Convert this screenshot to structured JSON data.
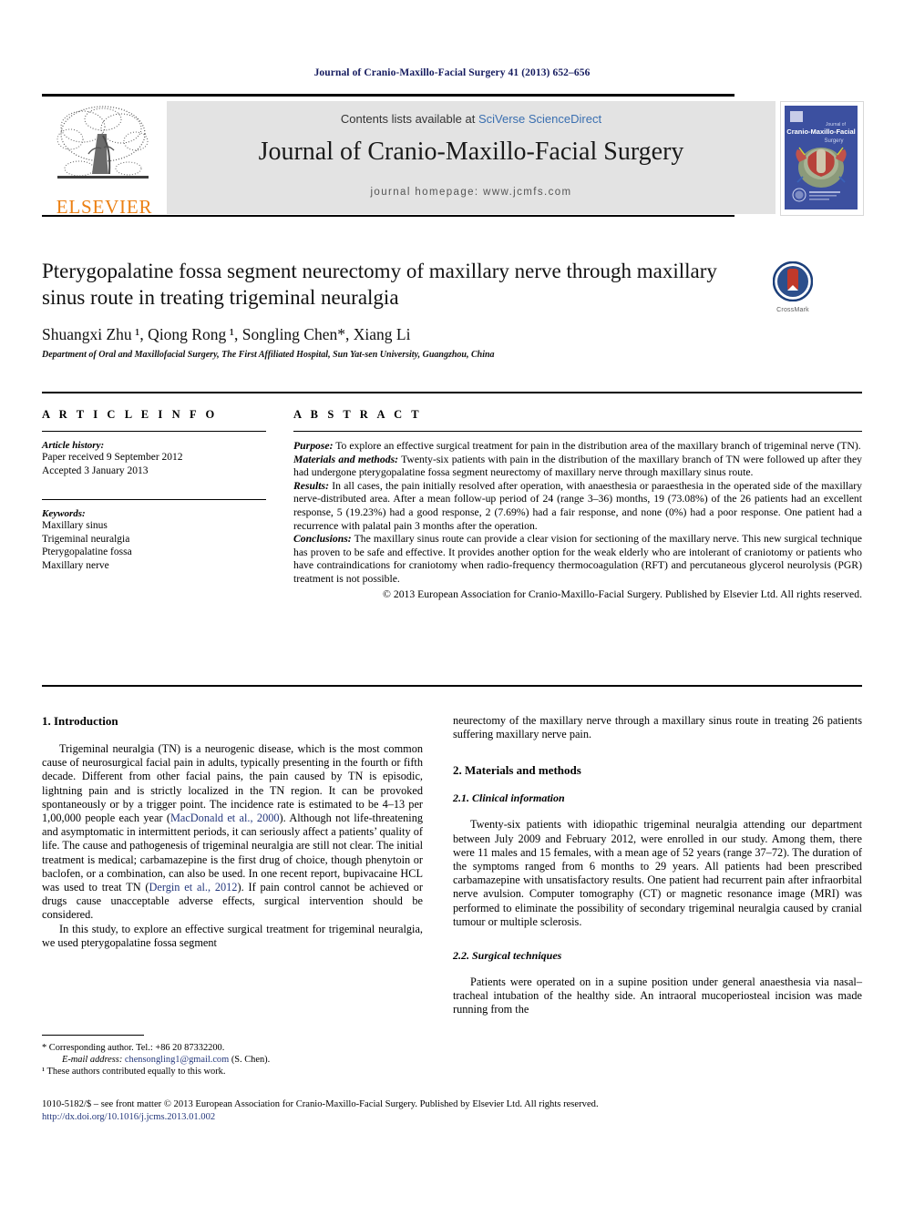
{
  "running_head": "Journal of Cranio-Maxillo-Facial Surgery 41 (2013) 652–656",
  "masthead": {
    "contents_prefix": "Contents lists available at ",
    "contents_link": "SciVerse ScienceDirect",
    "journal_name": "Journal of Cranio-Maxillo-Facial Surgery",
    "homepage": "journal homepage: www.jcmfs.com",
    "publisher_logo_text": "ELSEVIER",
    "cover_title_line1": "Journal of",
    "cover_title_line2": "Cranio-Maxillo-Facial",
    "cover_title_line3": "Surgery",
    "cover_bg_color": "#3c50a0"
  },
  "article": {
    "title": "Pterygopalatine fossa segment neurectomy of maxillary nerve through maxillary sinus route in treating trigeminal neuralgia",
    "authors": "Shuangxi Zhu ¹, Qiong Rong ¹, Songling Chen*, Xiang Li",
    "affiliation": "Department of Oral and Maxillofacial Surgery, The First Affiliated Hospital, Sun Yat-sen University, Guangzhou, China",
    "crossmark_label": "CrossMark"
  },
  "article_info": {
    "heading": "A R T I C L E   I N F O",
    "history_label": "Article history:",
    "history_lines": [
      "Paper received 9 September 2012",
      "Accepted 3 January 2013"
    ],
    "keywords_label": "Keywords:",
    "keywords": [
      "Maxillary sinus",
      "Trigeminal neuralgia",
      "Pterygopalatine fossa",
      "Maxillary nerve"
    ]
  },
  "abstract": {
    "heading": "A B S T R A C T",
    "purpose_label": "Purpose:",
    "purpose_text": " To explore an effective surgical treatment for pain in the distribution area of the maxillary branch of trigeminal nerve (TN).",
    "materials_label": "Materials and methods:",
    "materials_text": " Twenty-six patients with pain in the distribution of the maxillary branch of TN were followed up after they had undergone pterygopalatine fossa segment neurectomy of maxillary nerve through maxillary sinus route.",
    "results_label": "Results:",
    "results_text": " In all cases, the pain initially resolved after operation, with anaesthesia or paraesthesia in the operated side of the maxillary nerve-distributed area. After a mean follow-up period of 24 (range 3–36) months, 19 (73.08%) of the 26 patients had an excellent response, 5 (19.23%) had a good response, 2 (7.69%) had a fair response, and none (0%) had a poor response. One patient had a recurrence with palatal pain 3 months after the operation.",
    "conclusions_label": "Conclusions:",
    "conclusions_text": " The maxillary sinus route can provide a clear vision for sectioning of the maxillary nerve. This new surgical technique has proven to be safe and effective. It provides another option for the weak elderly who are intolerant of craniotomy or patients who have contraindications for craniotomy when radio-frequency thermocoagulation (RFT) and percutaneous glycerol neurolysis (PGR) treatment is not possible.",
    "copyright": "© 2013 European Association for Cranio-Maxillo-Facial Surgery. Published by Elsevier Ltd. All rights reserved."
  },
  "body": {
    "intro_heading": "1.  Introduction",
    "intro_p1_a": "Trigeminal neuralgia (TN) is a neurogenic disease, which is the most common cause of neurosurgical facial pain in adults, typically presenting in the fourth or fifth decade. Different from other facial pains, the pain caused by TN is episodic, lightning pain and is strictly localized in the TN region. It can be provoked spontaneously or by a trigger point. The incidence rate is estimated to be 4–13 per 1,00,000 people each year (",
    "intro_ref1": "MacDonald et al., 2000",
    "intro_p1_b": "). Although not life-threatening and asymptomatic in intermittent periods, it can seriously affect a patients’ quality of life. The cause and pathogenesis of trigeminal neuralgia are still not clear. The initial treatment is medical; carbamazepine is the first drug of choice, though phenytoin or baclofen, or a combination, can also be used. In one recent report, bupivacaine HCL was used to treat TN (",
    "intro_ref2": "Dergin et al., 2012",
    "intro_p1_c": "). If pain control cannot be achieved or drugs cause unacceptable adverse effects, surgical intervention should be considered.",
    "intro_p2": "In this study, to explore an effective surgical treatment for trigeminal neuralgia, we used pterygopalatine fossa segment",
    "right_cont": "neurectomy of the maxillary nerve through a maxillary sinus route in treating 26 patients suffering maxillary nerve pain.",
    "materials_heading": "2.  Materials and methods",
    "clinical_heading": "2.1.  Clinical information",
    "clinical_p": "Twenty-six patients with idiopathic trigeminal neuralgia attending our department between July 2009 and February 2012, were enrolled in our study. Among them, there were 11 males and 15 females, with a mean age of 52 years (range 37–72). The duration of the symptoms ranged from 6 months to 29 years. All patients had been prescribed carbamazepine with unsatisfactory results. One patient had recurrent pain after infraorbital nerve avulsion. Computer tomography (CT) or magnetic resonance image (MRI) was performed to eliminate the possibility of secondary trigeminal neuralgia caused by cranial tumour or multiple sclerosis.",
    "surgical_heading": "2.2.  Surgical techniques",
    "surgical_p": "Patients were operated on in a supine position under general anaesthesia via nasal–tracheal intubation of the healthy side. An intraoral mucoperiosteal incision was made running from the"
  },
  "footnotes": {
    "corresponding": "* Corresponding author. Tel.: +86 20 87332200.",
    "email_label": "E-mail address:",
    "email": "chensongling1@gmail.com",
    "email_suffix": " (S. Chen).",
    "equal_contrib": "¹  These authors contributed equally to this work."
  },
  "bottom": {
    "front_matter": "1010-5182/$ – see front matter © 2013 European Association for Cranio-Maxillo-Facial Surgery. Published by Elsevier Ltd. All rights reserved.",
    "doi": "http://dx.doi.org/10.1016/j.jcms.2013.01.002"
  }
}
